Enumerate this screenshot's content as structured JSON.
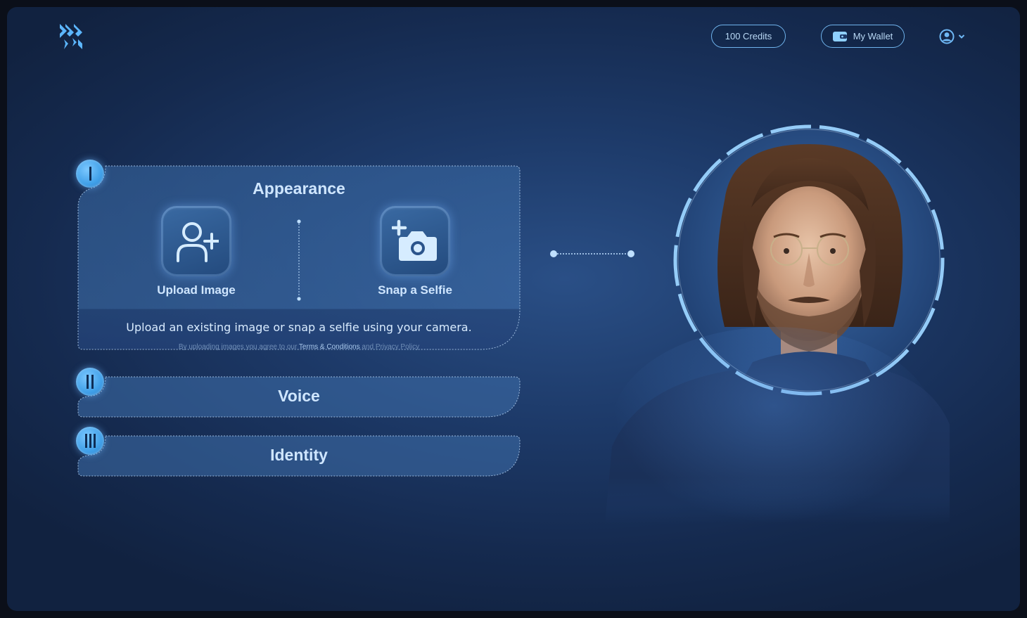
{
  "header": {
    "credits_label": "100 Credits",
    "wallet_label": "My Wallet"
  },
  "steps": [
    {
      "numeral": "I",
      "title": "Appearance",
      "options": [
        {
          "label": "Upload Image",
          "icon": "add-user-icon"
        },
        {
          "label": "Snap a Selfie",
          "icon": "add-camera-icon"
        }
      ],
      "description": "Upload an existing image or snap a selfie using your camera.",
      "legal_prefix": "By uploading images you agree to  our ",
      "legal_terms": "Terms & Conditions",
      "legal_and": " and ",
      "legal_privacy": "Privacy Policy"
    },
    {
      "numeral": "II",
      "title": "Voice"
    },
    {
      "numeral": "III",
      "title": "Identity"
    }
  ],
  "colors": {
    "accent": "#5cb6ff",
    "background_center": "#2a4f86",
    "background_edge": "#112240",
    "text_light": "#cfe6ff"
  }
}
